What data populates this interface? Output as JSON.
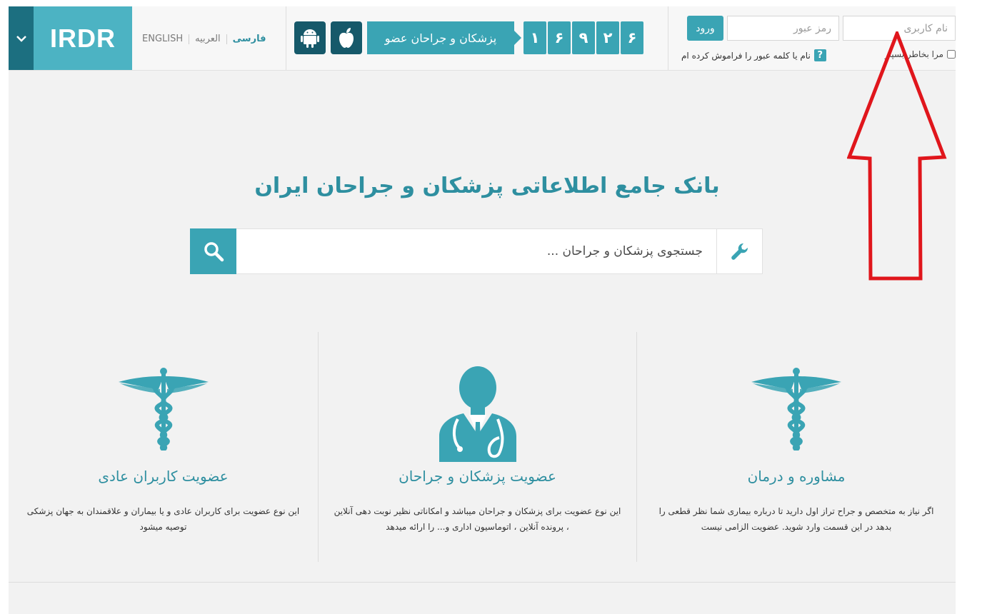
{
  "header": {
    "logo": "IRDR",
    "languages": [
      "فارسی",
      "العربیه",
      "ENGLISH"
    ],
    "stats_digits": [
      "۶",
      "۲",
      "۹",
      "۶",
      "۱"
    ],
    "members_label": "پزشکان و جراحان عضو",
    "apps": [
      "apple-icon",
      "android-icon"
    ]
  },
  "login": {
    "username_placeholder": "نام کاربری",
    "password_placeholder": "رمز عبور",
    "login_label": "ورود",
    "remember_label": "مرا بخاطر بسپار",
    "forgot_label": "نام یا کلمه عبور را فراموش کرده ام",
    "forgot_icon_text": "?"
  },
  "hero": {
    "title": "بانک جامع اطلاعاتی پزشکان و جراحان ایران",
    "search_placeholder": "جستجوی پزشکان و جراحان ..."
  },
  "features": [
    {
      "title": "مشاوره و درمان",
      "icon": "caduceus-icon",
      "desc": "اگر نیاز به متخصص و جراح تراز اول دارید تا درباره بیماری شما نظر قطعی را بدهد در این قسمت وارد شوید. عضویت الزامی نیست"
    },
    {
      "title": "عضویت پزشکان و جراحان",
      "icon": "doctor-icon",
      "desc": "این نوع عضویت برای پزشکان و جراحان میباشد و امکاناتی نظیر نوبت دهی آنلاین ، پرونده آنلاین ، اتوماسیون اداری و... را ارائه میدهد"
    },
    {
      "title": "عضویت کاربران عادی",
      "icon": "caduceus-icon",
      "desc": "این نوع عضویت برای کاربران عادی و یا بیماران و علاقمندان به جهان پزشکی توصیه میشود"
    }
  ],
  "colors": {
    "teal": "#3aa4b4",
    "dark_teal": "#16596a",
    "annotation_red": "#e0161c"
  },
  "annotation": {
    "icon": "red-arrow-up-icon"
  }
}
